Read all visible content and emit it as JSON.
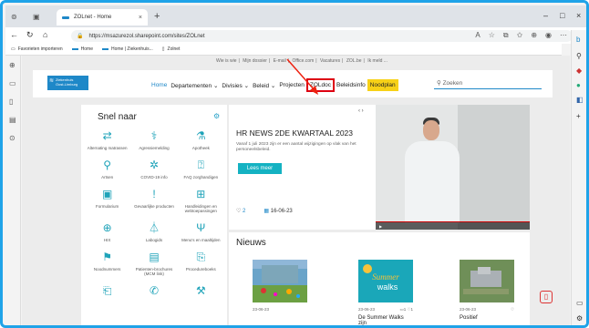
{
  "browser": {
    "tab_title": "ZOLnet - Home",
    "tab_close": "×",
    "new_tab": "+",
    "url": "https://msazurezol.sharepoint.com/sites/ZOLnet",
    "favorites": [
      {
        "label": "Favorieten importeren"
      },
      {
        "label": "Home"
      },
      {
        "label": "Home | Ziekenhuis..."
      },
      {
        "label": "Zolnet"
      }
    ],
    "window_controls": [
      "–",
      "□",
      "×"
    ]
  },
  "top_links": [
    "Wie is wie",
    "Mijn dossier",
    "E-mail",
    "Office.com",
    "Vacatures",
    "ZOL.be",
    "Ik meld ..."
  ],
  "logo": {
    "line1": "Ziekenhuis",
    "line2": "Oost-Limburg"
  },
  "menu": {
    "home": "Home",
    "departementen": "Departementen ⌄",
    "divisies": "Divisies ⌄",
    "beleid": "Beleid ⌄",
    "projecten": "Projecten",
    "zoldoc": "ZOLdoc",
    "beleidsinfo": "Beleidsinfo",
    "noodplan": "Noodplan"
  },
  "search": {
    "placeholder": "Zoeken"
  },
  "snel_naar": {
    "title": "Snel naar",
    "items": [
      {
        "icon": "⇄",
        "label": "Alternating matrassen"
      },
      {
        "icon": "⚕",
        "label": "Agressiemelding"
      },
      {
        "icon": "⚗",
        "label": "Apotheek"
      },
      {
        "icon": "⚲",
        "label": "Artsen"
      },
      {
        "icon": "✲",
        "label": "COVID-19 info"
      },
      {
        "icon": "⍰",
        "label": "FAQ zorghandigen"
      },
      {
        "icon": "▣",
        "label": "Formularium"
      },
      {
        "icon": "!",
        "label": "Gevaarlijke producten"
      },
      {
        "icon": "⊞",
        "label": "Handleidingen en webtoepassingen"
      },
      {
        "icon": "⊕",
        "label": "HIX"
      },
      {
        "icon": "⏃",
        "label": "Labogids"
      },
      {
        "icon": "Ψ",
        "label": "Menu's en maaltijden"
      },
      {
        "icon": "⚑",
        "label": "Noodnummers"
      },
      {
        "icon": "▤",
        "label": "Patienten-brochures (MCM link)"
      },
      {
        "icon": "⎘",
        "label": "Procedureboeks"
      },
      {
        "icon": "⎗",
        "label": ""
      },
      {
        "icon": "✆",
        "label": ""
      },
      {
        "icon": "⚒",
        "label": ""
      }
    ]
  },
  "hr_news": {
    "title": "HR NEWS 2DE KWARTAAL 2023",
    "text": "Vanaf 1 juli 2023 zijn er een aantal wijzigingen op vlak van het personeelsbeleid.",
    "button": "Lees meer",
    "likes": "2",
    "date": "16-06-23",
    "pager": "‹  ›"
  },
  "news": {
    "title": "Nieuws",
    "cards": [
      {
        "date": "23-06-23",
        "title": ""
      },
      {
        "date": "23-06-23",
        "title": "De Summer Walks zijn"
      },
      {
        "date": "23-06-23",
        "title": "Positief"
      }
    ]
  },
  "colors": {
    "accent": "#1e88c8",
    "teal": "#14b2c2",
    "noodplan": "#f7d117",
    "highlight": "#dd0011"
  }
}
